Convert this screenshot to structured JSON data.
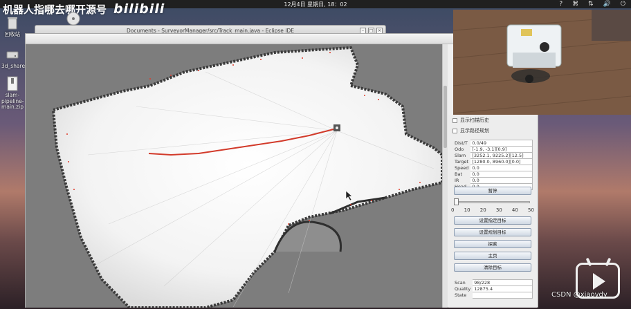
{
  "topbar": {
    "clock": "12月4日 星期日, 18：02",
    "tray": [
      "?",
      "⌘",
      "⇅",
      "🔊",
      "⏻"
    ]
  },
  "watermark": {
    "text": "机器人指哪去哪开源号",
    "logo": "bilibili"
  },
  "desktop_icons": [
    {
      "label": "回收站"
    },
    {
      "label": "3d_share"
    },
    {
      "label": "slam-pipeline-main.zip"
    }
  ],
  "eclipse_window": {
    "title": "Documents - SurveyorManager/src/Track_main.java - Eclipse IDE"
  },
  "panel": {
    "checkboxes": [
      {
        "label": "显示扫描历史",
        "checked": false
      },
      {
        "label": "显示路径规划",
        "checked": false
      }
    ],
    "status_rows": [
      {
        "key": "Dist/T",
        "value": "0.0/49"
      },
      {
        "key": "Odo",
        "value": "[-1.9, -3.1][0.9]"
      },
      {
        "key": "Slam",
        "value": "[3252.1, 9225.2][12.5]"
      },
      {
        "key": "Target",
        "value": "[1280.0, 8960.0][0.0]"
      },
      {
        "key": "Speed",
        "value": "0.0"
      },
      {
        "key": "Bat",
        "value": "0.0"
      },
      {
        "key": "IR",
        "value": "0.0"
      },
      {
        "key": "Head",
        "value": "0.0"
      }
    ],
    "pause_button": "暂停",
    "slider": {
      "value": 0,
      "ticks": [
        "0",
        "10",
        "20",
        "30",
        "40",
        "50"
      ]
    },
    "buttons": [
      "设置指定目标",
      "设置规划目标",
      "探索",
      "主页",
      "清除目标"
    ],
    "scan_rows": [
      {
        "key": "Scan",
        "value": "98/228"
      },
      {
        "key": "Quality",
        "value": "12875.4"
      },
      {
        "key": "State",
        "value": ""
      }
    ]
  },
  "map": {
    "path_color": "#d23a2a",
    "obstacle_color": "#e03a2a"
  },
  "footer": {
    "csdn": "CSDN @xiaovdy"
  }
}
